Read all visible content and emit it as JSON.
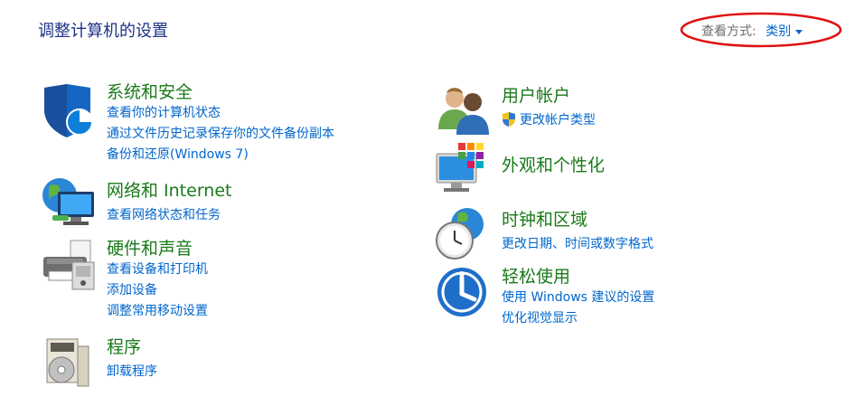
{
  "header": {
    "title": "调整计算机的设置",
    "view_by_label": "查看方式:",
    "view_by_value": "类别"
  },
  "categories": [
    {
      "icon": "security-shield-icon",
      "title": "系统和安全",
      "links": [
        "查看你的计算机状态",
        "通过文件历史记录保存你的文件备份副本",
        "备份和还原(Windows 7)"
      ]
    },
    {
      "icon": "network-globe-icon",
      "title": "网络和 Internet",
      "links": [
        "查看网络状态和任务"
      ]
    },
    {
      "icon": "printer-icon",
      "title": "硬件和声音",
      "links": [
        "查看设备和打印机",
        "添加设备",
        "调整常用移动设置"
      ]
    },
    {
      "icon": "programs-disc-icon",
      "title": "程序",
      "links": [
        "卸载程序"
      ]
    },
    {
      "icon": "users-icon",
      "title": "用户帐户",
      "links": [
        "更改帐户类型"
      ]
    },
    {
      "icon": "monitor-color-icon",
      "title": "外观和个性化",
      "links": []
    },
    {
      "icon": "clock-globe-icon",
      "title": "时钟和区域",
      "links": [
        "更改日期、时间或数字格式"
      ]
    },
    {
      "icon": "ease-of-access-icon",
      "title": "轻松使用",
      "links": [
        "使用 Windows 建议的设置",
        "优化视觉显示"
      ]
    }
  ],
  "colors": {
    "title_green": "#1a7a1a",
    "link_blue": "#0066cc",
    "header_blue": "#1e3287",
    "annotation_red": "#e01010"
  }
}
